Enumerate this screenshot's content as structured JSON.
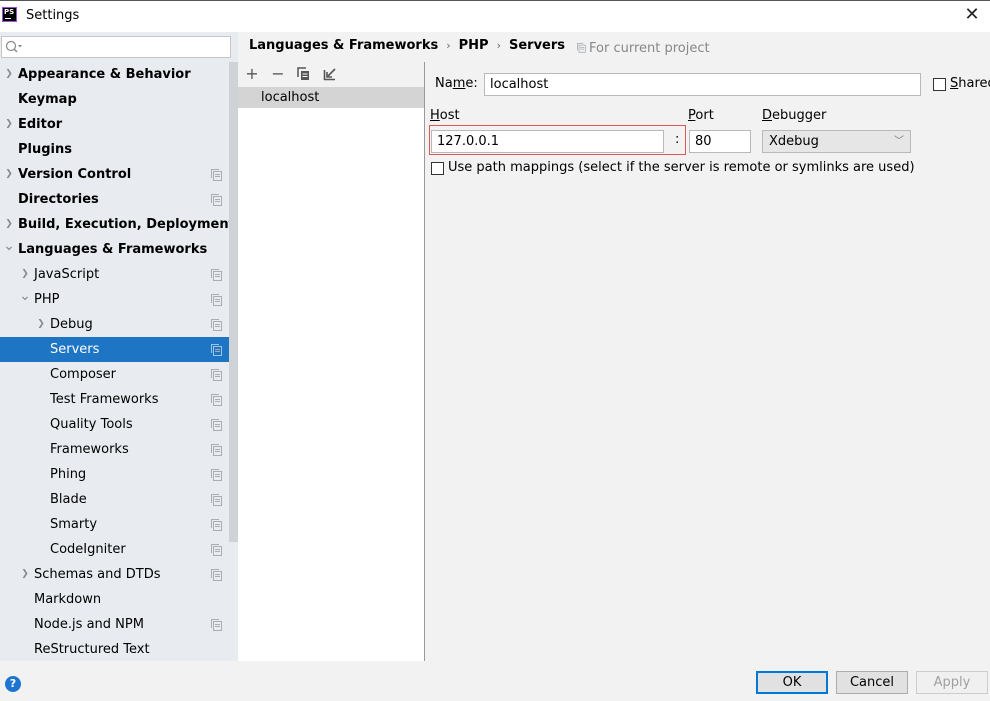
{
  "window": {
    "title": "Settings",
    "app_icon": "PS",
    "close_icon": "close-icon"
  },
  "search": {
    "placeholder": "",
    "value": ""
  },
  "sidebar": {
    "items": [
      {
        "label": "Appearance & Behavior",
        "level": 0,
        "bold": true,
        "chevron": "right",
        "project_icon": false,
        "selected": false
      },
      {
        "label": "Keymap",
        "level": 0,
        "bold": true,
        "chevron": "none",
        "project_icon": false,
        "selected": false
      },
      {
        "label": "Editor",
        "level": 0,
        "bold": true,
        "chevron": "right",
        "project_icon": false,
        "selected": false
      },
      {
        "label": "Plugins",
        "level": 0,
        "bold": true,
        "chevron": "none",
        "project_icon": false,
        "selected": false
      },
      {
        "label": "Version Control",
        "level": 0,
        "bold": true,
        "chevron": "right",
        "project_icon": true,
        "selected": false
      },
      {
        "label": "Directories",
        "level": 0,
        "bold": true,
        "chevron": "none",
        "project_icon": true,
        "selected": false
      },
      {
        "label": "Build, Execution, Deployment",
        "level": 0,
        "bold": true,
        "chevron": "right",
        "project_icon": false,
        "selected": false
      },
      {
        "label": "Languages & Frameworks",
        "level": 0,
        "bold": true,
        "chevron": "down",
        "project_icon": false,
        "selected": false
      },
      {
        "label": "JavaScript",
        "level": 1,
        "bold": false,
        "chevron": "right",
        "project_icon": true,
        "selected": false
      },
      {
        "label": "PHP",
        "level": 1,
        "bold": false,
        "chevron": "down",
        "project_icon": true,
        "selected": false
      },
      {
        "label": "Debug",
        "level": 2,
        "bold": false,
        "chevron": "right",
        "project_icon": true,
        "selected": false
      },
      {
        "label": "Servers",
        "level": 2,
        "bold": false,
        "chevron": "none",
        "project_icon": true,
        "selected": true
      },
      {
        "label": "Composer",
        "level": 2,
        "bold": false,
        "chevron": "none",
        "project_icon": true,
        "selected": false
      },
      {
        "label": "Test Frameworks",
        "level": 2,
        "bold": false,
        "chevron": "none",
        "project_icon": true,
        "selected": false
      },
      {
        "label": "Quality Tools",
        "level": 2,
        "bold": false,
        "chevron": "none",
        "project_icon": true,
        "selected": false
      },
      {
        "label": "Frameworks",
        "level": 2,
        "bold": false,
        "chevron": "none",
        "project_icon": true,
        "selected": false
      },
      {
        "label": "Phing",
        "level": 2,
        "bold": false,
        "chevron": "none",
        "project_icon": true,
        "selected": false
      },
      {
        "label": "Blade",
        "level": 2,
        "bold": false,
        "chevron": "none",
        "project_icon": true,
        "selected": false
      },
      {
        "label": "Smarty",
        "level": 2,
        "bold": false,
        "chevron": "none",
        "project_icon": true,
        "selected": false
      },
      {
        "label": "CodeIgniter",
        "level": 2,
        "bold": false,
        "chevron": "none",
        "project_icon": true,
        "selected": false
      },
      {
        "label": "Schemas and DTDs",
        "level": 1,
        "bold": false,
        "chevron": "right",
        "project_icon": true,
        "selected": false
      },
      {
        "label": "Markdown",
        "level": 1,
        "bold": false,
        "chevron": "none",
        "project_icon": false,
        "selected": false
      },
      {
        "label": "Node.js and NPM",
        "level": 1,
        "bold": false,
        "chevron": "none",
        "project_icon": true,
        "selected": false
      },
      {
        "label": "ReStructured Text",
        "level": 1,
        "bold": false,
        "chevron": "none",
        "project_icon": false,
        "selected": false
      }
    ]
  },
  "breadcrumb": {
    "items": [
      "Languages & Frameworks",
      "PHP",
      "Servers"
    ],
    "separator": "›",
    "scope_note": "For current project"
  },
  "servers_list": {
    "toolbar": {
      "add": "+",
      "remove": "−",
      "copy": "copy-icon",
      "import": "import-icon"
    },
    "items": [
      "localhost"
    ],
    "selected": "localhost"
  },
  "form": {
    "name_label_pre": "Na",
    "name_label_mnemonic": "m",
    "name_label_post": "e:",
    "name_value": "localhost",
    "shared_label_mnemonic": "S",
    "shared_label_rest": "hared",
    "shared_checked": false,
    "host_label_mnemonic": "H",
    "host_label_rest": "ost",
    "host_value": "127.0.0.1",
    "colon": ":",
    "port_label_mnemonic": "P",
    "port_label_rest": "ort",
    "port_value": "80",
    "debugger_label_mnemonic": "D",
    "debugger_label_rest": "ebugger",
    "debugger_value": "Xdebug",
    "path_mappings_label": "Use path mappings (select if the server is remote or symlinks are used)",
    "path_mappings_checked": false
  },
  "footer": {
    "help": "?",
    "ok": "OK",
    "cancel": "Cancel",
    "apply": "Apply"
  },
  "colors": {
    "selection": "#1e75c3",
    "sidebar_bg": "#e8ecf0",
    "host_outline": "#e05555",
    "ok_border": "#0078d7"
  }
}
